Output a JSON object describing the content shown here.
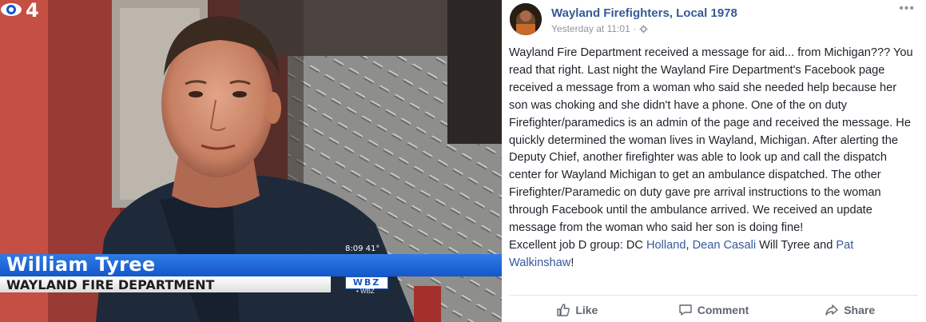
{
  "tv": {
    "name": "William Tyree",
    "org": "WAYLAND FIRE DEPARTMENT",
    "clock": "8:09  41°",
    "station": "WBZ",
    "station_small": "• WBZ"
  },
  "post": {
    "page_name": "Wayland Firefighters, Local 1978",
    "timestamp": "Yesterday at 11:01 ·",
    "more": "•••",
    "body": "Wayland Fire Department received a message for aid... from Michigan??? You read that right. Last night the Wayland Fire Department's Facebook page received a message from a woman who said she needed help because her son was choking and she didn't have a phone. One of the on duty Firefighter/paramedics is an admin of the page and received the message. He quickly determined the woman lives in Wayland, Michigan. After alerting the Deputy Chief, another firefighter was able to look up and call the dispatch center for Wayland Michigan to get an ambulance dispatched. The other Firefighter/Paramedic on duty gave pre arrival instructions to the woman through Facebook until the ambulance arrived. We received an update message from the woman who said her son is doing fine!",
    "closing_prefix": "Excellent job D group: DC ",
    "tag1": "Holland",
    "sep1": ", ",
    "tag2": "Dean Casali",
    "mid": " Will Tyree and ",
    "tag3": "Pat Walkinshaw",
    "end": "!"
  },
  "actions": {
    "like": "Like",
    "comment": "Comment",
    "share": "Share"
  }
}
